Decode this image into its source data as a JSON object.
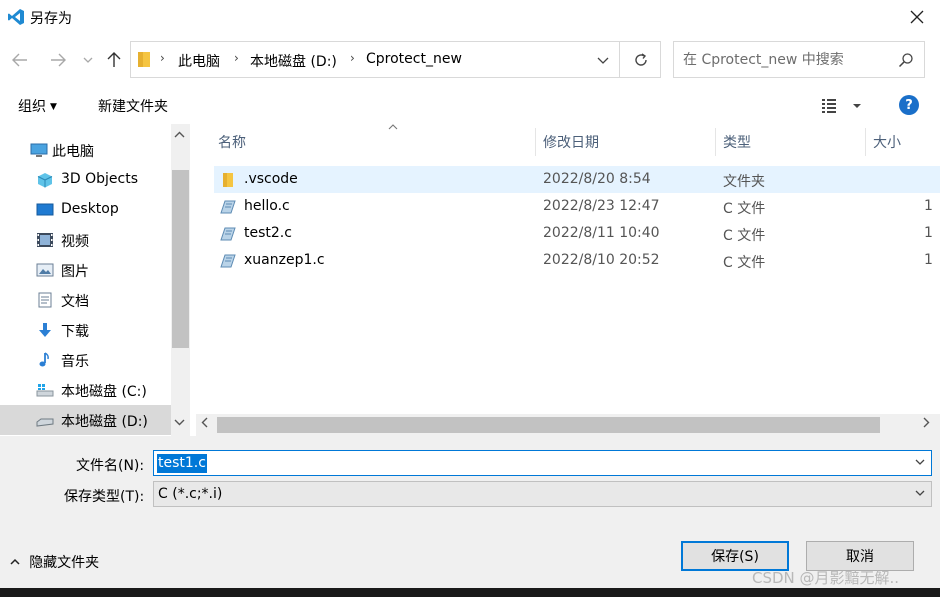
{
  "window": {
    "title": "另存为"
  },
  "address": {
    "crumbs": [
      "此电脑",
      "本地磁盘 (D:)",
      "Cprotect_new"
    ]
  },
  "search": {
    "placeholder": "在 Cprotect_new 中搜索"
  },
  "toolbar": {
    "organize_label": "组织",
    "new_folder_label": "新建文件夹",
    "help_label": "?"
  },
  "nav": {
    "items": [
      {
        "label": "此电脑",
        "icon": "computer-icon"
      },
      {
        "label": "3D Objects",
        "icon": "3d-objects-icon"
      },
      {
        "label": "Desktop",
        "icon": "desktop-icon"
      },
      {
        "label": "视频",
        "icon": "video-icon"
      },
      {
        "label": "图片",
        "icon": "pictures-icon"
      },
      {
        "label": "文档",
        "icon": "documents-icon"
      },
      {
        "label": "下载",
        "icon": "downloads-icon"
      },
      {
        "label": "音乐",
        "icon": "music-icon"
      },
      {
        "label": "本地磁盘 (C:)",
        "icon": "drive-c-icon"
      },
      {
        "label": "本地磁盘 (D:)",
        "icon": "drive-d-icon"
      }
    ]
  },
  "columns": {
    "name": "名称",
    "modified": "修改日期",
    "type": "类型",
    "size": "大小"
  },
  "files": [
    {
      "name": ".vscode",
      "modified": "2022/8/20 8:54",
      "type": "文件夹",
      "size": "",
      "icon": "folder-icon"
    },
    {
      "name": "hello.c",
      "modified": "2022/8/23 12:47",
      "type": "C 文件",
      "size": "1",
      "icon": "c-file-icon"
    },
    {
      "name": "test2.c",
      "modified": "2022/8/11 10:40",
      "type": "C 文件",
      "size": "1",
      "icon": "c-file-icon"
    },
    {
      "name": "xuanzep1.c",
      "modified": "2022/8/10 20:52",
      "type": "C 文件",
      "size": "1",
      "icon": "c-file-icon"
    }
  ],
  "form": {
    "filename_label": "文件名(N):",
    "filename_value": "test1.c",
    "filetype_label": "保存类型(T):",
    "filetype_value": "C (*.c;*.i)"
  },
  "footer": {
    "hide_folders_label": "隐藏文件夹",
    "save_label": "保存(S)",
    "cancel_label": "取消"
  },
  "watermark": "CSDN @月影黯无解.."
}
